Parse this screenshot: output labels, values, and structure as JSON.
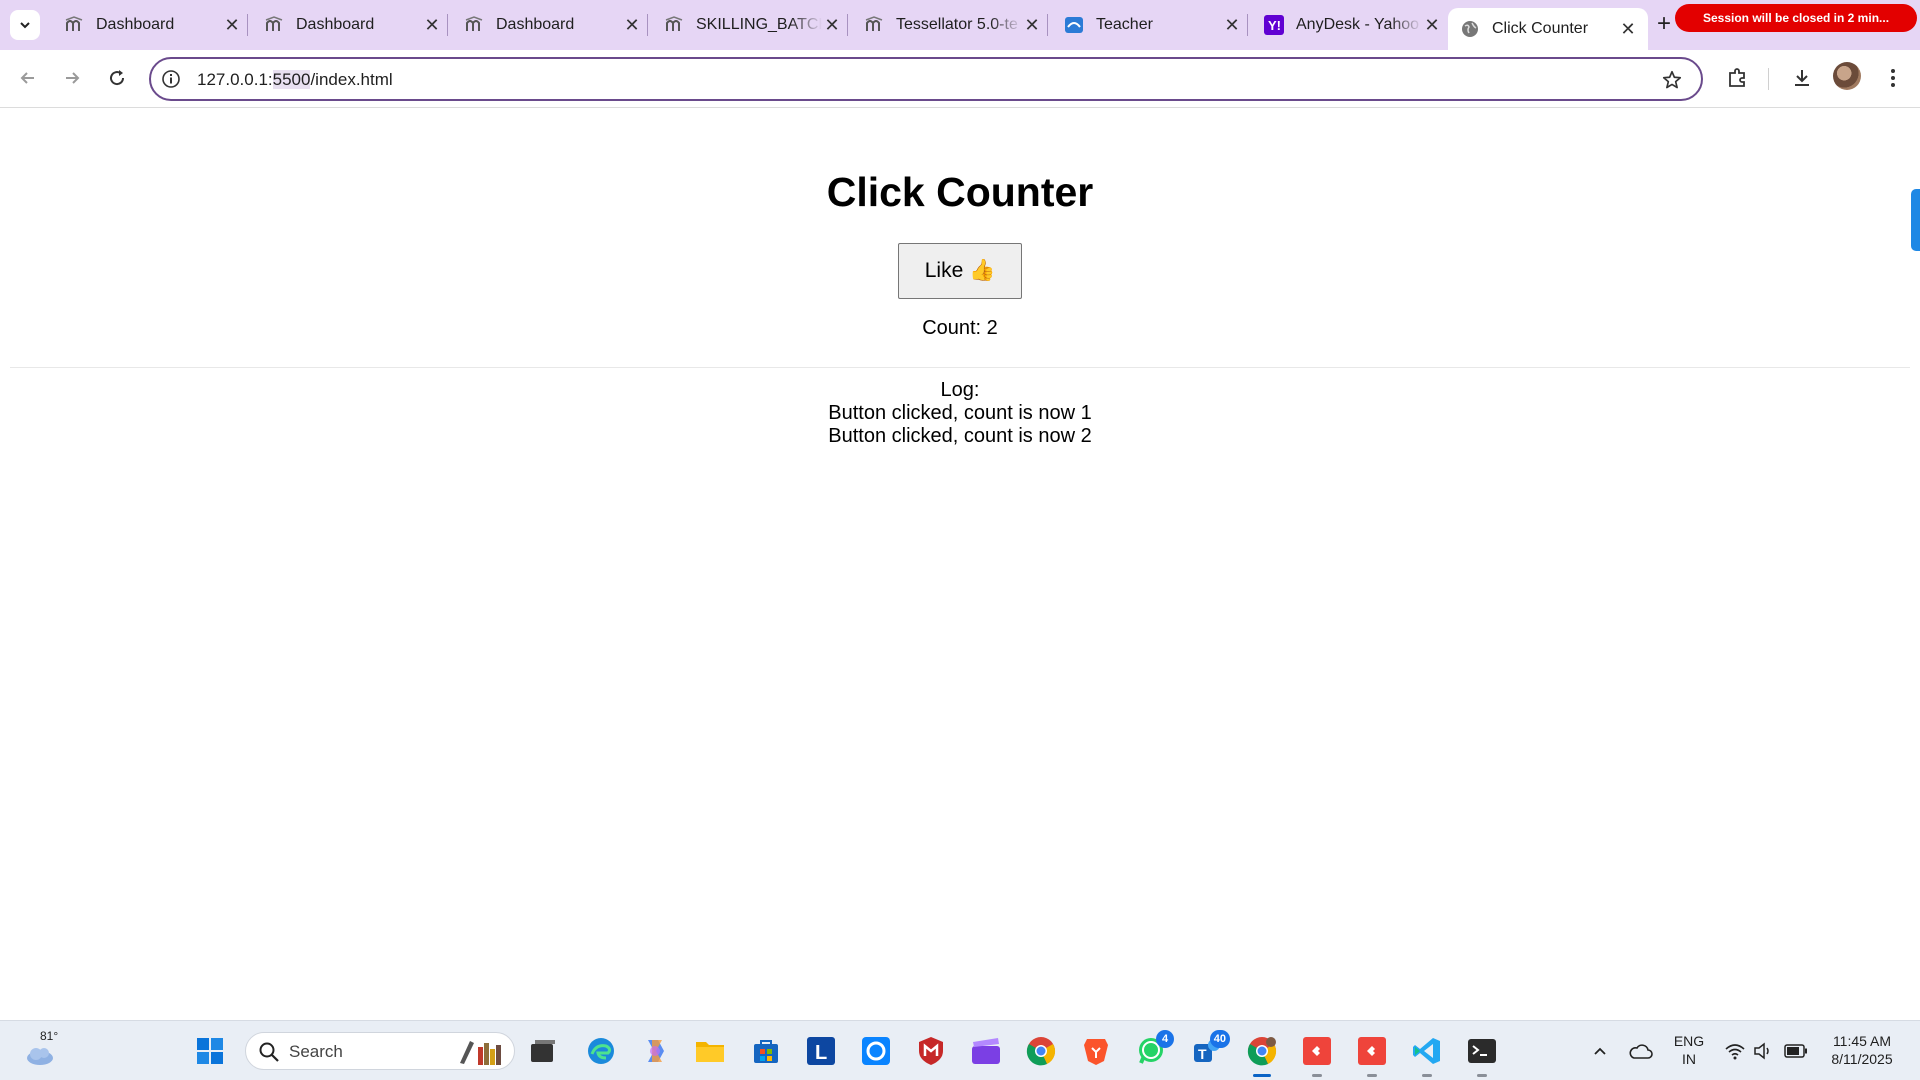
{
  "browser": {
    "tabs": [
      {
        "label": "Dashboard",
        "icon": "moodle-icon",
        "active": false
      },
      {
        "label": "Dashboard",
        "icon": "moodle-icon",
        "active": false
      },
      {
        "label": "Dashboard",
        "icon": "moodle-icon",
        "active": false
      },
      {
        "label": "SKILLING_BATCH",
        "icon": "moodle-icon",
        "active": false
      },
      {
        "label": "Tessellator 5.0-te",
        "icon": "moodle-icon",
        "active": false
      },
      {
        "label": "Teacher",
        "icon": "teacher-icon",
        "active": false
      },
      {
        "label": "AnyDesk - Yahoo",
        "icon": "yahoo-icon",
        "active": false
      },
      {
        "label": "Click Counter",
        "icon": "globe-icon",
        "active": true
      }
    ],
    "session_notice": "Session will be closed in 2 min...",
    "address": {
      "prefix": "127.0.0.1:",
      "port": "5500",
      "path": "/index.html"
    }
  },
  "page": {
    "title": "Click Counter",
    "like_button": "Like 👍",
    "count_label": "Count: 2",
    "log_heading": "Log:",
    "log_entries": [
      "Button clicked, count is now 1",
      "Button clicked, count is now 2"
    ]
  },
  "taskbar": {
    "weather_temp": "81°",
    "search_placeholder": "Search",
    "whatsapp_badge": "4",
    "teams_badge": "40",
    "language": "ENG",
    "region": "IN",
    "time": "11:45 AM",
    "date": "8/11/2025"
  },
  "colors": {
    "tabstrip": "#e6d6f5",
    "session_pill": "#e30000",
    "omnibox_border": "#6a4a8c",
    "taskbar": "#e9eef5"
  }
}
